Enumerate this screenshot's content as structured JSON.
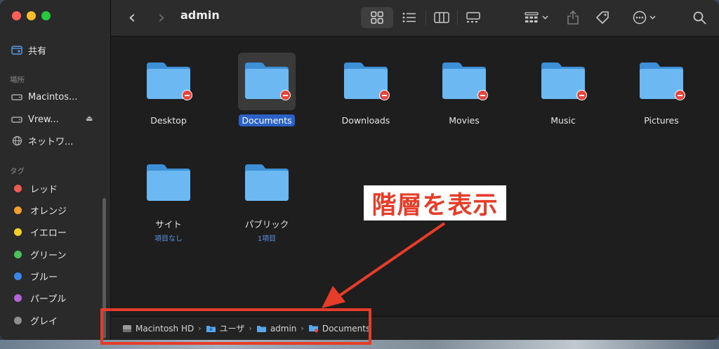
{
  "window": {
    "title": "admin"
  },
  "sidebar": {
    "shared_label": "共有",
    "locations_header": "場所",
    "locations": [
      {
        "label": "Macintos...",
        "icon": "hard-drive-icon"
      },
      {
        "label": "Vrew...",
        "icon": "hard-drive-icon",
        "eject": "⏏"
      },
      {
        "label": "ネットワ...",
        "icon": "network-globe-icon"
      }
    ],
    "tags_header": "タグ",
    "tags": [
      {
        "label": "レッド",
        "color": "#ec5a55"
      },
      {
        "label": "オレンジ",
        "color": "#f39d2c"
      },
      {
        "label": "イエロー",
        "color": "#f5d024"
      },
      {
        "label": "グリーン",
        "color": "#4cc05a"
      },
      {
        "label": "ブルー",
        "color": "#3b86e8"
      },
      {
        "label": "パープル",
        "color": "#b364d8"
      },
      {
        "label": "グレイ",
        "color": "#8e8e92"
      }
    ]
  },
  "toolbar": {
    "back": "‹",
    "forward": "›"
  },
  "items": [
    {
      "label": "Desktop",
      "badge": true,
      "selected": false,
      "sub": ""
    },
    {
      "label": "Documents",
      "badge": true,
      "selected": true,
      "sub": ""
    },
    {
      "label": "Downloads",
      "badge": true,
      "selected": false,
      "sub": ""
    },
    {
      "label": "Movies",
      "badge": true,
      "selected": false,
      "sub": ""
    },
    {
      "label": "Music",
      "badge": true,
      "selected": false,
      "sub": ""
    },
    {
      "label": "Pictures",
      "badge": true,
      "selected": false,
      "sub": ""
    },
    {
      "label": "サイト",
      "badge": false,
      "selected": false,
      "sub": "項目なし"
    },
    {
      "label": "パブリック",
      "badge": false,
      "selected": false,
      "sub": "1項目"
    }
  ],
  "pathbar": {
    "crumbs": [
      "Macintosh HD",
      "ユーザ",
      "admin",
      "Documents"
    ],
    "separator": "›"
  },
  "annotation": {
    "label": "階層を表示",
    "color": "#e63d2a"
  }
}
